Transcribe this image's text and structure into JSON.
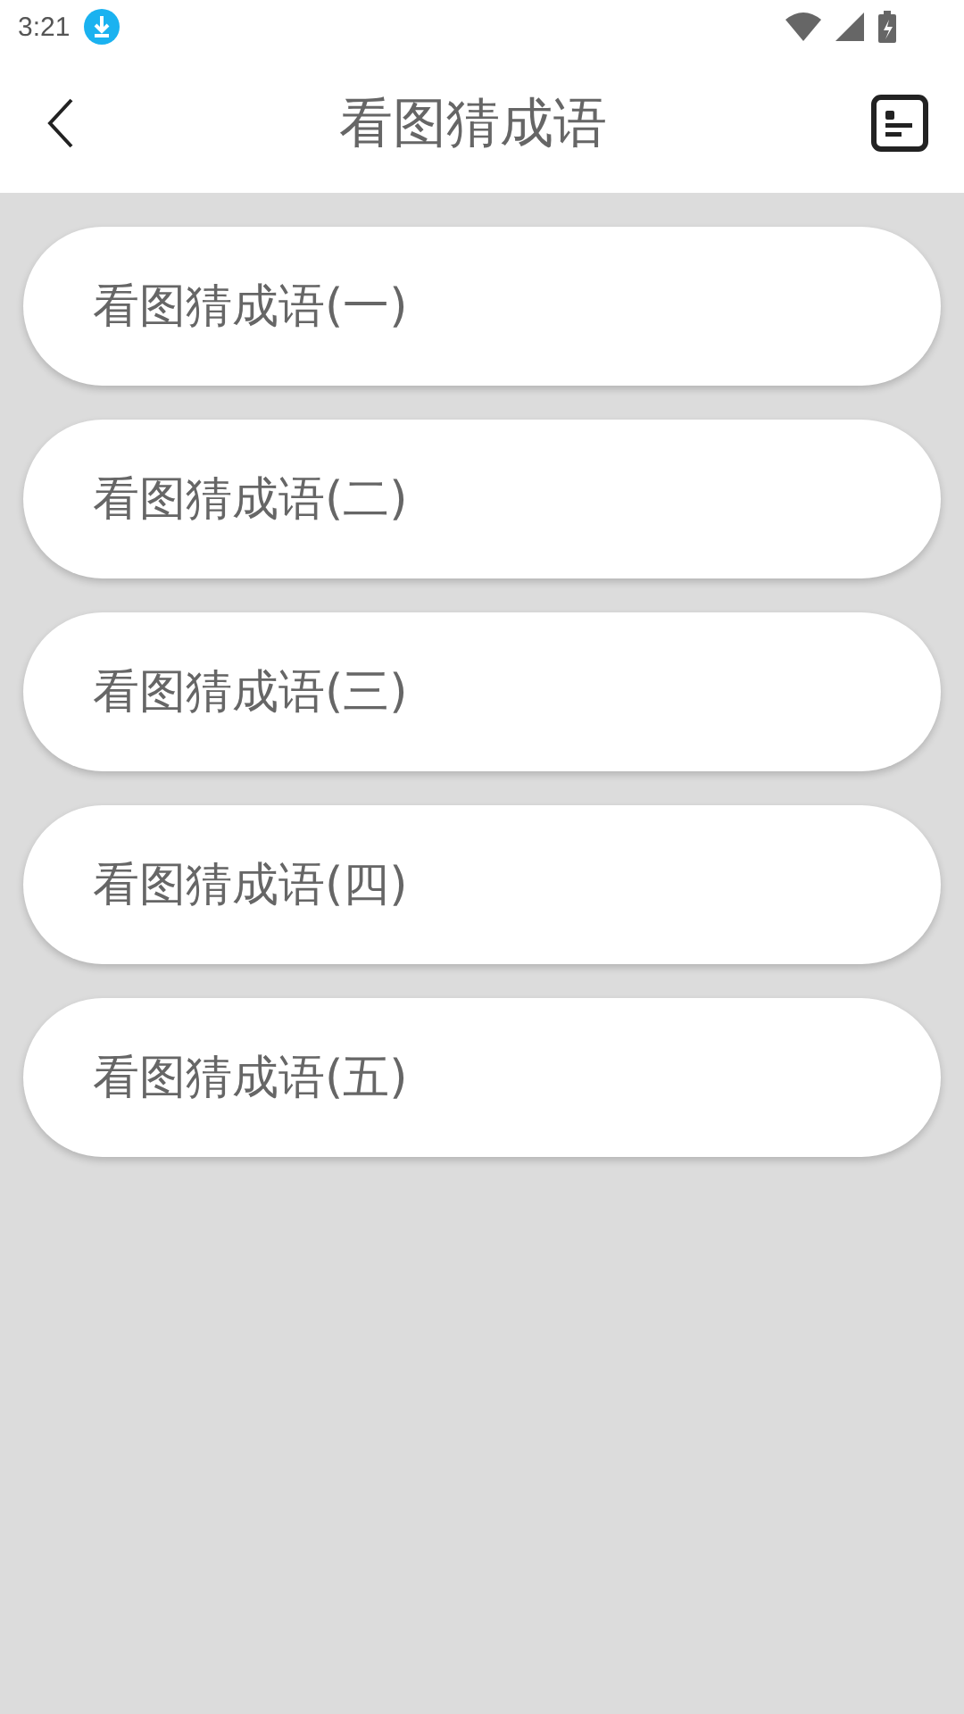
{
  "status_bar": {
    "time": "3:21"
  },
  "header": {
    "title": "看图猜成语"
  },
  "levels": [
    {
      "label": "看图猜成语(一)"
    },
    {
      "label": "看图猜成语(二)"
    },
    {
      "label": "看图猜成语(三)"
    },
    {
      "label": "看图猜成语(四)"
    },
    {
      "label": "看图猜成语(五)"
    }
  ]
}
